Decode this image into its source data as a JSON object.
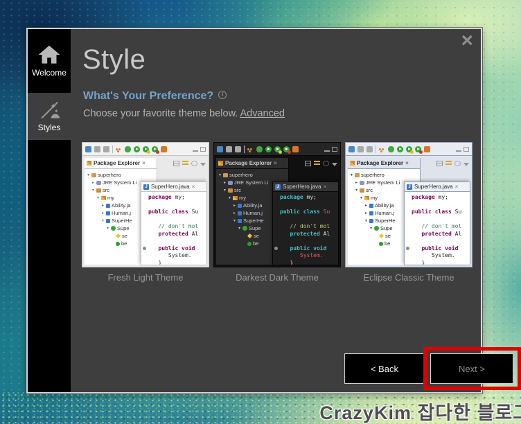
{
  "window": {
    "close_icon": "×"
  },
  "sidebar": {
    "items": [
      {
        "id": "welcome",
        "label": "Welcome",
        "selected": false
      },
      {
        "id": "styles",
        "label": "Styles",
        "selected": true
      }
    ]
  },
  "page": {
    "title": "Style",
    "heading": "What's Your Preference?",
    "info_icon": "i",
    "subtext": "Choose your favorite theme below.",
    "advanced_link": "Advanced"
  },
  "buttons": {
    "back": "< Back",
    "next": "Next >"
  },
  "annotation": {
    "highlight_color": "#e00000",
    "target": "next-button"
  },
  "watermark": "CrazyKim 잡다한 블로그",
  "thumbnail_content": {
    "explorer_tab": "Package Explorer",
    "editor_tab": "SuperHero.java",
    "tab_close_icon": "×",
    "java_badge": "J",
    "window_icons": [
      "minimize",
      "maximize"
    ],
    "toolbar_icons": [
      {
        "name": "new-wizard-icon",
        "shape": "square",
        "color": "#4a86c8"
      },
      {
        "name": "save-icon",
        "shape": "square",
        "color": "#a8a8a8"
      },
      {
        "name": "save-all-icon",
        "shape": "square",
        "color": "#a8a8a8"
      },
      {
        "name": "separator",
        "shape": "sep",
        "color": "#bbbbbb"
      },
      {
        "name": "breakpoints-icon",
        "shape": "dots",
        "color": "#cc8833"
      },
      {
        "name": "debug-bug-icon",
        "shape": "bug",
        "color": "#3fa93f"
      },
      {
        "name": "run-icon",
        "shape": "run",
        "color": "#2ea52e"
      },
      {
        "name": "run-external-icon",
        "shape": "run-q",
        "color": "#2ea52e"
      },
      {
        "name": "coverage-icon",
        "shape": "run-r",
        "color": "#2ea52e"
      },
      {
        "name": "new-java-icon",
        "shape": "square",
        "color": "#d8762a"
      }
    ],
    "view_icons": [
      {
        "name": "collapse-all-icon",
        "shape": "collapse"
      },
      {
        "name": "filters-icon",
        "shape": "filters"
      },
      {
        "name": "link-editor-icon",
        "shape": "target"
      },
      {
        "name": "view-menu-icon",
        "shape": "chevron"
      }
    ],
    "tree": [
      {
        "indent": 0,
        "arrow": "▾",
        "icon": "project-folder",
        "label": "superhero"
      },
      {
        "indent": 1,
        "arrow": "▸",
        "icon": "jre-library",
        "label": "JRE System Li"
      },
      {
        "indent": 1,
        "arrow": "▾",
        "icon": "src-folder",
        "label": "src"
      },
      {
        "indent": 2,
        "arrow": "▾",
        "icon": "package",
        "label": "my"
      },
      {
        "indent": 3,
        "arrow": "▸",
        "icon": "java-file",
        "label": "Ability.ja"
      },
      {
        "indent": 3,
        "arrow": "▸",
        "icon": "java-file",
        "label": "Human.j"
      },
      {
        "indent": 3,
        "arrow": "▾",
        "icon": "java-file",
        "label": "SuperHe"
      },
      {
        "indent": 4,
        "arrow": "▾",
        "icon": "class",
        "label": "Supe"
      },
      {
        "indent": 5,
        "arrow": "",
        "icon": "field",
        "label": "se"
      },
      {
        "indent": 5,
        "arrow": "",
        "icon": "method",
        "label": "be"
      }
    ],
    "code": [
      {
        "tokens": [
          {
            "c": "kw",
            "t": "package"
          },
          {
            "c": "pl",
            "t": " my;"
          }
        ]
      },
      {
        "tokens": []
      },
      {
        "tokens": [
          {
            "c": "kw",
            "t": "public class "
          },
          {
            "c": "cls",
            "t": "Su"
          }
        ]
      },
      {
        "tokens": []
      },
      {
        "tokens": [
          {
            "c": "cm",
            "t": "   // don't mol"
          }
        ]
      },
      {
        "tokens": [
          {
            "c": "kw",
            "t": "   protected"
          },
          {
            "c": "pl",
            "t": " Al"
          }
        ]
      },
      {
        "tokens": []
      },
      {
        "tokens": [
          {
            "c": "kw",
            "t": "   public void"
          }
        ],
        "marker": true
      },
      {
        "tokens": [
          {
            "c": "sys",
            "t": "      System."
          }
        ]
      },
      {
        "tokens": [
          {
            "c": "pl",
            "t": "   }"
          }
        ]
      }
    ]
  },
  "themes": [
    {
      "id": "fresh-light",
      "label": "Fresh Light Theme",
      "colors": {
        "outer": "#e9e9e9",
        "frame": "#fdfdfd",
        "toolbar": "#f2f2f2",
        "border": "#c4c4c4",
        "panel": "#ffffff",
        "headerBg": "#ffffff",
        "text": "#333333",
        "arrow": "#777777",
        "editorBg": "#ffffff",
        "tabBg": "#f6f6f6",
        "kw": "#7b0052",
        "cm": "#3f7f5f",
        "cls": "#333333",
        "pl": "#333333",
        "sys": "#333333"
      }
    },
    {
      "id": "darkest-dark",
      "label": "Darkest Dark Theme",
      "colors": {
        "outer": "#101010",
        "frame": "#1b1b1b",
        "toolbar": "#252525",
        "border": "#070707",
        "panel": "#2d2d2d",
        "headerBg": "#2d2d2d",
        "text": "#cccccc",
        "arrow": "#bbbbbb",
        "editorBg": "#1f1f1f",
        "tabBg": "#333333",
        "kw": "#46c0c8",
        "cm": "#c8c878",
        "cls": "#e05c5c",
        "pl": "#dddddd",
        "sys": "#e05c5c"
      }
    },
    {
      "id": "eclipse-classic",
      "label": "Eclipse Classic Theme",
      "colors": {
        "outer": "#dfe4ec",
        "frame": "#edf0f4",
        "toolbar": "#e8ecf2",
        "border": "#93a1b6",
        "panel": "#ffffff",
        "headerBg": "#dde4ee",
        "text": "#222222",
        "arrow": "#555555",
        "editorBg": "#ffffff",
        "tabBg": "#eef2f8",
        "kw": "#7b0052",
        "cm": "#3f7f5f",
        "cls": "#222222",
        "pl": "#222222",
        "sys": "#222222"
      }
    }
  ]
}
